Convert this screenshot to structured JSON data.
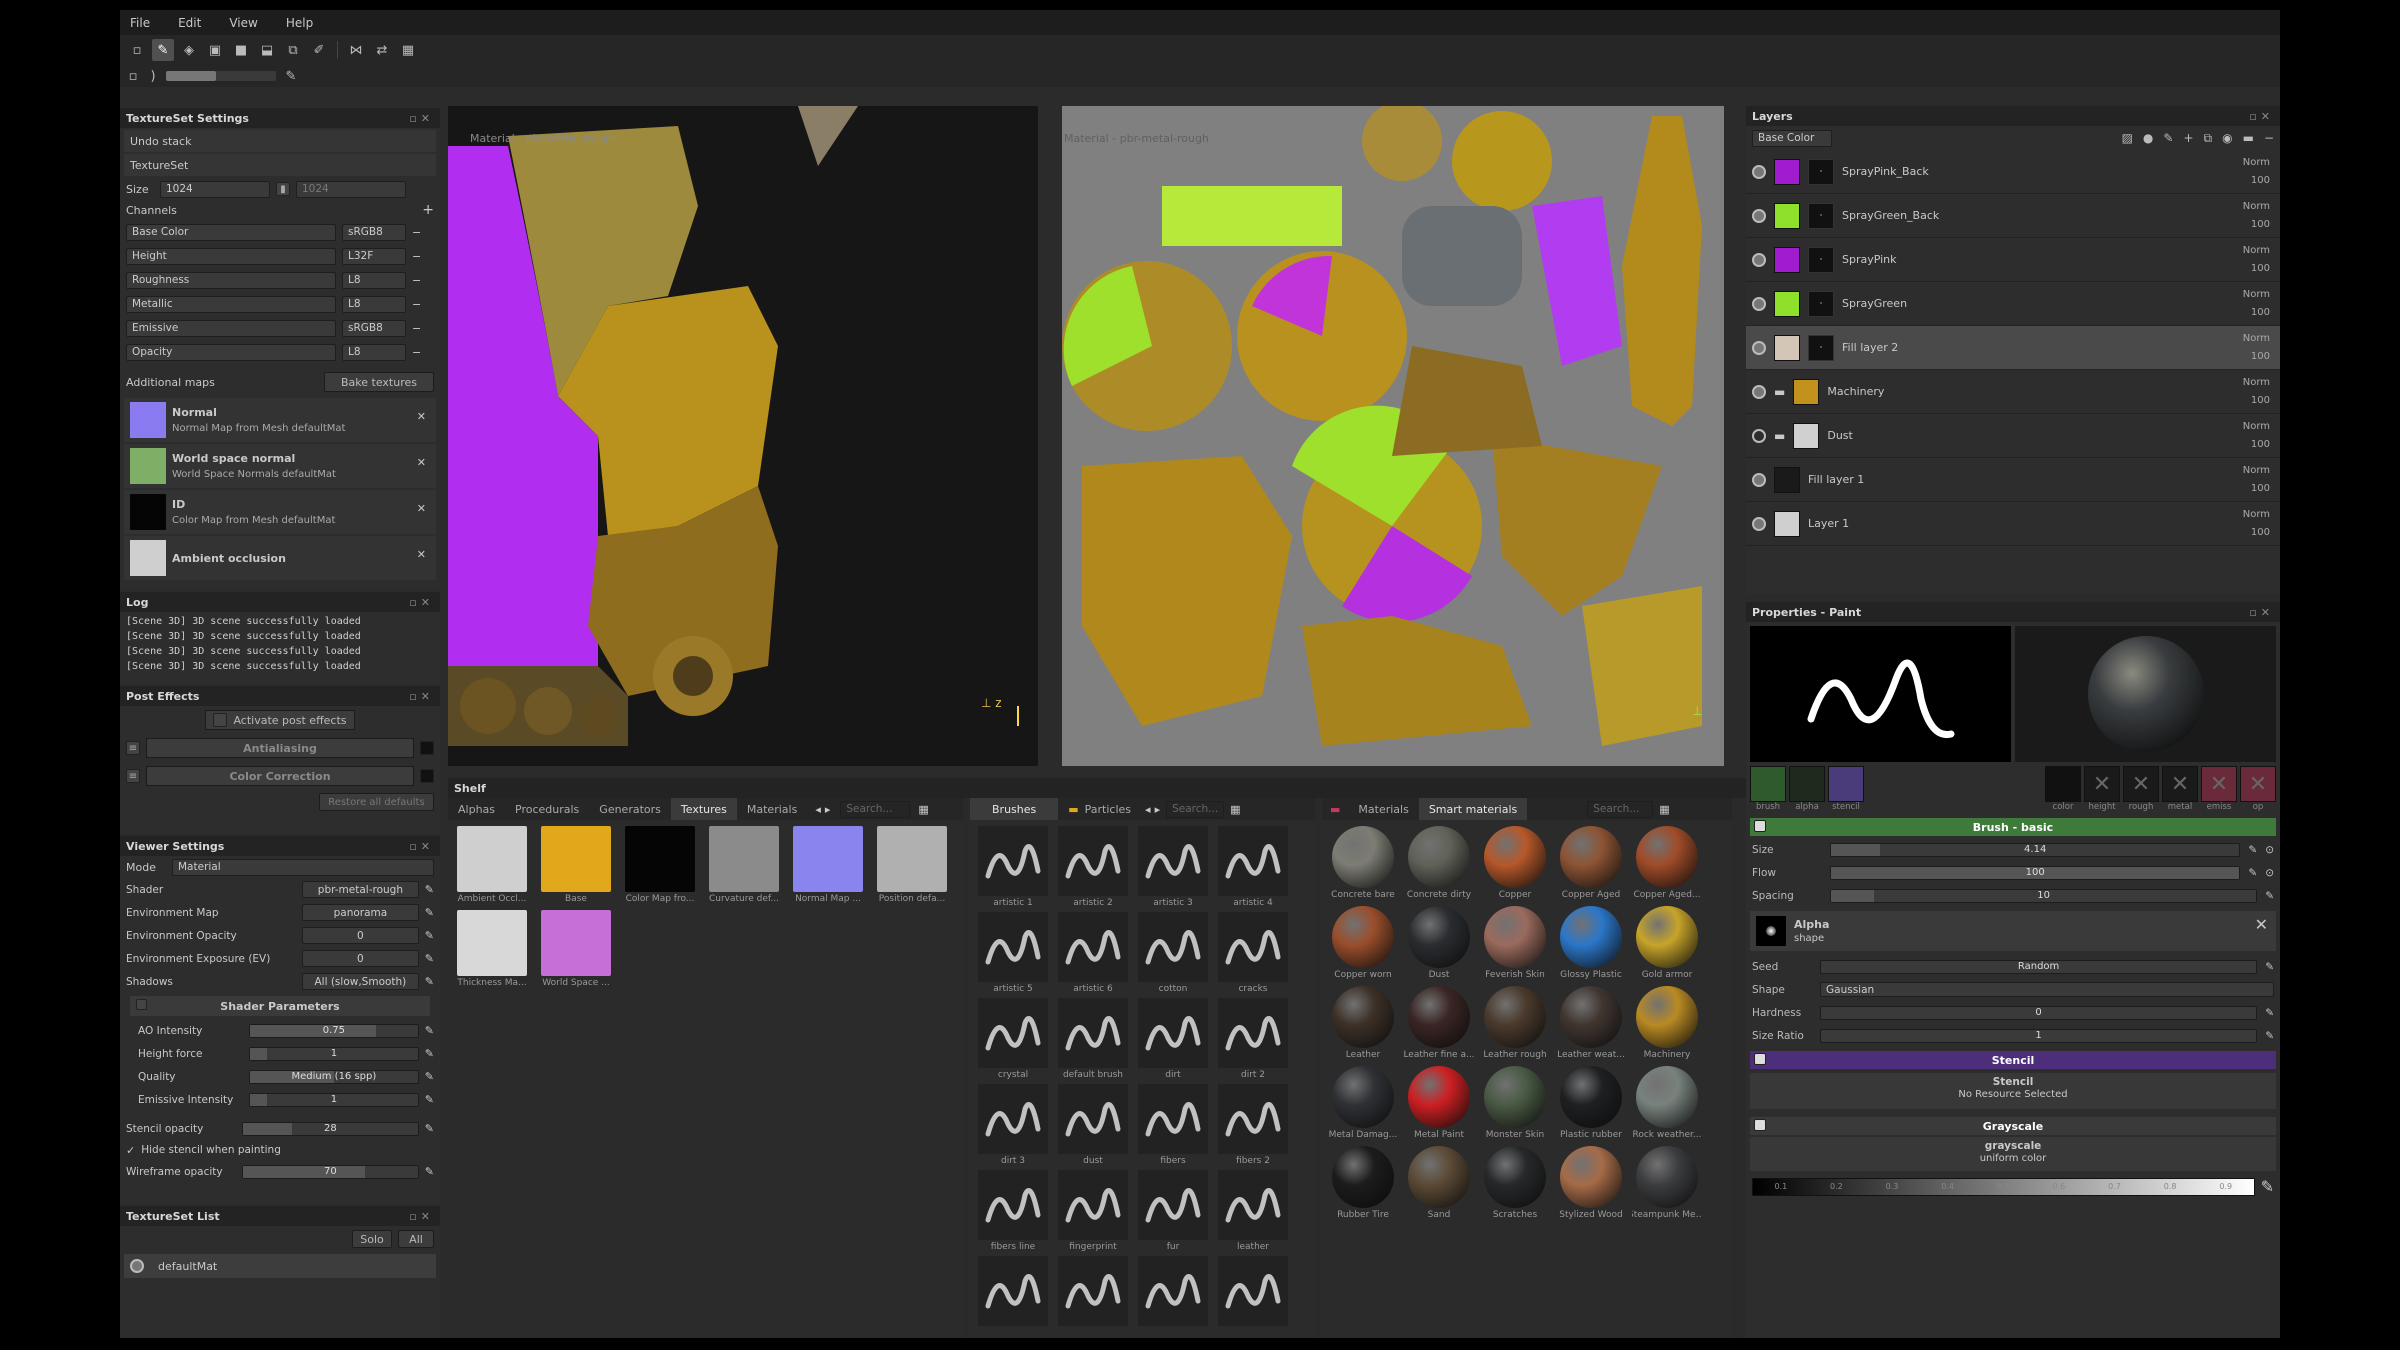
{
  "menu": [
    "File",
    "Edit",
    "View",
    "Help"
  ],
  "textureset_settings": {
    "title": "TextureSet Settings",
    "undo_stack": "Undo stack",
    "textureset_label": "TextureSet",
    "size_label": "Size",
    "size_value": "1024",
    "size_value2": "1024",
    "channels_label": "Channels",
    "channels": [
      {
        "name": "Base Color",
        "format": "sRGB8"
      },
      {
        "name": "Height",
        "format": "L32F"
      },
      {
        "name": "Roughness",
        "format": "L8"
      },
      {
        "name": "Metallic",
        "format": "L8"
      },
      {
        "name": "Emissive",
        "format": "sRGB8"
      },
      {
        "name": "Opacity",
        "format": "L8"
      }
    ],
    "additional_maps": "Additional maps",
    "bake_textures": "Bake textures",
    "maps": [
      {
        "name": "Normal",
        "desc": "Normal Map from Mesh defaultMat",
        "color": "#8a7cf0"
      },
      {
        "name": "World space normal",
        "desc": "World Space Normals defaultMat",
        "color": "#7fae66"
      },
      {
        "name": "ID",
        "desc": "Color Map from Mesh defaultMat",
        "color": "#050505"
      },
      {
        "name": "Ambient occlusion",
        "desc": "",
        "color": "#cfcfcf"
      }
    ]
  },
  "log": {
    "title": "Log",
    "lines": [
      "[Scene 3D] 3D scene successfully loaded",
      "[Scene 3D] 3D scene successfully loaded",
      "[Scene 3D] 3D scene successfully loaded",
      "[Scene 3D] 3D scene successfully loaded"
    ]
  },
  "post_effects": {
    "title": "Post Effects",
    "activate": "Activate post effects",
    "items": [
      "Antialiasing",
      "Color Correction"
    ],
    "restore": "Restore all defaults"
  },
  "viewer_settings": {
    "title": "Viewer Settings",
    "mode_label": "Mode",
    "mode_value": "Material",
    "rows": [
      {
        "label": "Shader",
        "value": "pbr-metal-rough"
      },
      {
        "label": "Environment Map",
        "value": "panorama"
      },
      {
        "label": "Environment Opacity",
        "value": "0"
      },
      {
        "label": "Environment Exposure (EV)",
        "value": "0"
      },
      {
        "label": "Shadows",
        "value": "All (slow,Smooth)"
      }
    ],
    "shader_params": "Shader Parameters",
    "params": [
      {
        "label": "AO Intensity",
        "value": "0.75"
      },
      {
        "label": "Height force",
        "value": "1"
      },
      {
        "label": "Quality",
        "value": "Medium (16 spp)"
      },
      {
        "label": "Emissive Intensity",
        "value": "1"
      }
    ],
    "stencil_opacity_label": "Stencil opacity",
    "stencil_opacity": "28",
    "hide_stencil": "Hide stencil when painting",
    "wireframe_label": "Wireframe opacity",
    "wireframe": "70"
  },
  "textureset_list": {
    "title": "TextureSet List",
    "solo": "Solo",
    "all": "All",
    "item": "defaultMat"
  },
  "viewport3d": {
    "label": "Material - pbr-metal-rough"
  },
  "viewport2d": {
    "label": "Material - pbr-metal-rough"
  },
  "shelf": {
    "title": "Shelf",
    "tabs1": [
      "Alphas",
      "Procedurals",
      "Generators",
      "Textures",
      "Materials"
    ],
    "active1": "Textures",
    "search": "Search...",
    "textures": [
      {
        "name": "Ambient Occl...",
        "color": "#cfcfcf"
      },
      {
        "name": "Base",
        "color": "#e0a81a"
      },
      {
        "name": "Color Map fro...",
        "color": "#050505"
      },
      {
        "name": "Curvature def...",
        "color": "#8b8b8b"
      },
      {
        "name": "Normal Map ...",
        "color": "#8a84ee"
      },
      {
        "name": "Position defa...",
        "color": "#b0b0b0"
      },
      {
        "name": "Thickness Ma...",
        "color": "#d8d8d8"
      },
      {
        "name": "World Space ...",
        "color": "#c66fd6"
      }
    ],
    "tabs2": [
      "Brushes",
      "Particles"
    ],
    "brushes": [
      "artistic 1",
      "artistic 2",
      "artistic 3",
      "artistic 4",
      "artistic 5",
      "artistic 6",
      "cotton",
      "cracks",
      "crystal",
      "default brush",
      "dirt",
      "dirt 2",
      "dirt 3",
      "dust",
      "fibers",
      "fibers 2",
      "fibers line",
      "fingerprint",
      "fur",
      "leather",
      "",
      "",
      "",
      ""
    ],
    "tabs3": [
      "Materials",
      "Smart materials"
    ],
    "materials": [
      {
        "name": "Concrete bare",
        "color": "#7d7d74"
      },
      {
        "name": "Concrete dirty",
        "color": "#606258"
      },
      {
        "name": "Copper",
        "color": "#b6582a"
      },
      {
        "name": "Copper Aged",
        "color": "#8d5434"
      },
      {
        "name": "Copper Aged...",
        "color": "#a04b28"
      },
      {
        "name": "Copper worn",
        "color": "#9a4e2c"
      },
      {
        "name": "Dust",
        "color": "#2a2d30"
      },
      {
        "name": "Feverish Skin",
        "color": "#9b6a5d"
      },
      {
        "name": "Glossy Plastic",
        "color": "#2b77c9"
      },
      {
        "name": "Gold armor",
        "color": "#c7a42a"
      },
      {
        "name": "Leather",
        "color": "#3d3128"
      },
      {
        "name": "Leather fine a...",
        "color": "#3a2624"
      },
      {
        "name": "Leather rough",
        "color": "#4a3a2c"
      },
      {
        "name": "Leather weat...",
        "color": "#403630"
      },
      {
        "name": "Machinery",
        "color": "#b98a23"
      },
      {
        "name": "Metal Damag...",
        "color": "#2f3135"
      },
      {
        "name": "Metal Paint",
        "color": "#cc1f22"
      },
      {
        "name": "Monster Skin",
        "color": "#4a5a44"
      },
      {
        "name": "Plastic rubber",
        "color": "#1e2022"
      },
      {
        "name": "Rock weather...",
        "color": "#78827d"
      },
      {
        "name": "Rubber Tire",
        "color": "#1c1c1c"
      },
      {
        "name": "Sand",
        "color": "#5b4a35"
      },
      {
        "name": "Scratches",
        "color": "#26292b"
      },
      {
        "name": "Stylized Wood",
        "color": "#a66b47"
      },
      {
        "name": "Steampunk Metal",
        "color": "#3c3d40"
      }
    ]
  },
  "layers": {
    "title": "Layers",
    "channel": "Base Color",
    "items": [
      {
        "name": "SprayPink_Back",
        "color": "#a21ccf",
        "mode": "Norm",
        "opacity": "100",
        "type": "fill"
      },
      {
        "name": "SprayGreen_Back",
        "color": "#8ee02a",
        "mode": "Norm",
        "opacity": "100",
        "type": "fill"
      },
      {
        "name": "SprayPink",
        "color": "#a21ccf",
        "mode": "Norm",
        "opacity": "100",
        "type": "fill"
      },
      {
        "name": "SprayGreen",
        "color": "#8ee02a",
        "mode": "Norm",
        "opacity": "100",
        "type": "fill"
      },
      {
        "name": "Fill layer 2",
        "color": "#d4c6b6",
        "mode": "Norm",
        "opacity": "100",
        "type": "fill"
      },
      {
        "name": "Machinery",
        "color": "#c3921d",
        "mode": "Norm",
        "opacity": "100",
        "type": "folder"
      },
      {
        "name": "Dust",
        "color": "#d0d0d0",
        "mode": "Norm",
        "opacity": "100",
        "type": "folder"
      },
      {
        "name": "Fill layer 1",
        "color": "#1a1a1a",
        "mode": "Norm",
        "opacity": "100",
        "type": "fill"
      },
      {
        "name": "Layer 1",
        "color": "#cfcfcf",
        "mode": "Norm",
        "opacity": "100",
        "type": "paint"
      }
    ]
  },
  "properties": {
    "title": "Properties - Paint",
    "tools": [
      "brush",
      "alpha",
      "stencil"
    ],
    "channels": [
      "color",
      "height",
      "rough",
      "metal",
      "emiss",
      "op"
    ],
    "brush_section": "Brush - basic",
    "size_label": "Size",
    "size": "4.14",
    "flow_label": "Flow",
    "flow": "100",
    "spacing_label": "Spacing",
    "spacing": "10",
    "alpha_title": "Alpha",
    "alpha_shape": "shape",
    "seed_label": "Seed",
    "seed": "Random",
    "shape_label": "Shape",
    "shape": "Gaussian",
    "hardness_label": "Hardness",
    "hardness": "0",
    "size_ratio_label": "Size Ratio",
    "size_ratio": "1",
    "stencil_section": "Stencil",
    "stencil_title": "Stencil",
    "stencil_value": "No Resource Selected",
    "grayscale_section": "Grayscale",
    "grayscale_title": "grayscale",
    "grayscale_sub": "uniform color",
    "gray_ticks": [
      "0.1",
      "0.2",
      "0.3",
      "0.4",
      "0.5",
      "0.6",
      "0.7",
      "0.8",
      "0.9"
    ]
  }
}
